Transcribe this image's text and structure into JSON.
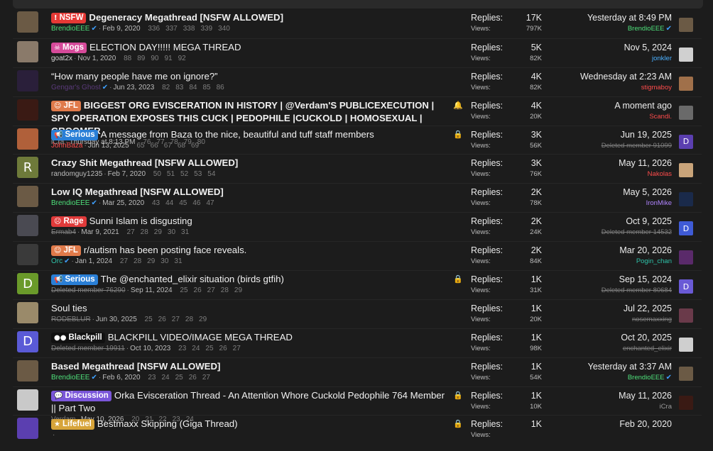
{
  "colors": {
    "nsfw": "#e53935",
    "mogs": "#d64a9a",
    "jfl": "#e07a4a",
    "serious": "#2a7fd6",
    "rage": "#e03a3a",
    "blackpill": "#111111",
    "discussion": "#7a56d9",
    "lifefuel": "#d7a43a",
    "user_red": "#ff4c4c",
    "user_orange": "#e07a3a",
    "user_blue": "#4ab0ff",
    "user_green": "#4ee07a",
    "user_purple": "#b084ff",
    "user_teal": "#2ec1a8",
    "verified": "#3ea0ff"
  },
  "threads": [
    {
      "prefix": {
        "label": "NSFW",
        "icon": "!",
        "color": "#e53935"
      },
      "title": "Degeneracy Megathread [NSFW ALLOWED]",
      "bold": true,
      "author": "BrendioEEE",
      "author_color": "#4ee07a",
      "verified": true,
      "date": "Feb 9, 2020",
      "pages": [
        "336",
        "337",
        "338",
        "339",
        "340"
      ],
      "replies_label": "Replies:",
      "replies": "17K",
      "views_label": "Views:",
      "views": "797K",
      "last_date": "Yesterday at 8:49 PM",
      "last_user": "BrendioEEE",
      "last_user_color": "#4ee07a",
      "last_verified": true,
      "avatar_glyph": "",
      "avatar_bg": "#6b5a45",
      "last_avatar_glyph": "",
      "last_avatar_bg": "#6b5a45",
      "status": ""
    },
    {
      "prefix": {
        "label": "Mogs",
        "icon": "☠",
        "color": "#d64a9a"
      },
      "title": "ELECTION DAY!!!!! MEGA THREAD",
      "bold": false,
      "author": "goat2x",
      "author_color": "#d9d9d9",
      "verified": false,
      "date": "Nov 1, 2020",
      "pages": [
        "88",
        "89",
        "90",
        "91",
        "92"
      ],
      "replies_label": "Replies:",
      "replies": "5K",
      "views_label": "Views:",
      "views": "82K",
      "last_date": "Nov 5, 2024",
      "last_user": "jonkler",
      "last_user_color": "#4ab0ff",
      "last_verified": false,
      "avatar_glyph": "",
      "avatar_bg": "#8a7a6a",
      "last_avatar_glyph": "",
      "last_avatar_bg": "#d0d0d0",
      "status": ""
    },
    {
      "prefix": null,
      "title": "“How many people have me on ignore?”",
      "bold": false,
      "author": "Gengar's Ghost",
      "author_color": "#5a3a7a",
      "verified": true,
      "date": "Jun 23, 2023",
      "pages": [
        "82",
        "83",
        "84",
        "85",
        "86"
      ],
      "replies_label": "Replies:",
      "replies": "4K",
      "views_label": "Views:",
      "views": "82K",
      "last_date": "Wednesday at 2:23 AM",
      "last_user": "stigmaboy",
      "last_user_color": "#ff4c4c",
      "last_verified": false,
      "avatar_glyph": "",
      "avatar_bg": "#2a1f3a",
      "last_avatar_glyph": "",
      "last_avatar_bg": "#a0704a",
      "status": ""
    },
    {
      "prefix": {
        "label": "JFL",
        "icon": "☺",
        "color": "#e07a4a"
      },
      "title": "BIGGEST ORG EVISCERATION IN HISTORY | @Verdam'S PUBLICEXECUTION | SPY OPERATION EXPOSES THIS CUCK | PEDOPHILE |CUCKOLD | HOMOSEXUAL | GROOMER",
      "bold": true,
      "author": "iCra",
      "author_color": "#9a9a9a",
      "verified": false,
      "date": "Thursday at 8:13 PM",
      "pages": [
        "76",
        "77",
        "78",
        "79",
        "80"
      ],
      "replies_label": "Replies:",
      "replies": "4K",
      "views_label": "Views:",
      "views": "20K",
      "last_date": "A moment ago",
      "last_user": "Scandi.",
      "last_user_color": "#ff4c4c",
      "last_verified": false,
      "avatar_glyph": "",
      "avatar_bg": "#3a1a14",
      "last_avatar_glyph": "",
      "last_avatar_bg": "#6a6a6a",
      "status": "🔔"
    },
    {
      "prefix": {
        "label": "Serious",
        "icon": "📢",
        "color": "#2a7fd6"
      },
      "title": "A message from Baza to the nice, beautiful and tuff staff members",
      "bold": false,
      "author": "JohnBaza",
      "author_color": "#ff4c4c",
      "verified": false,
      "date": "Jun 13, 2025",
      "pages": [
        "65",
        "66",
        "67",
        "68",
        "69"
      ],
      "replies_label": "Replies:",
      "replies": "3K",
      "views_label": "Views:",
      "views": "56K",
      "last_date": "Jun 19, 2025",
      "last_user": "Deleted member 91099",
      "last_user_color": "#7f7f7f",
      "last_verified": false,
      "last_strike": true,
      "avatar_glyph": "",
      "avatar_bg": "#b0603a",
      "last_avatar_glyph": "D",
      "last_avatar_bg": "#5b3fb0",
      "status": "🔒"
    },
    {
      "prefix": null,
      "title": "Crazy Shit Megathread [NSFW ALLOWED]",
      "bold": true,
      "author": "randomguy1235",
      "author_color": "#bdbdbd",
      "verified": false,
      "date": "Feb 7, 2020",
      "pages": [
        "50",
        "51",
        "52",
        "53",
        "54"
      ],
      "replies_label": "Replies:",
      "replies": "3K",
      "views_label": "Views:",
      "views": "76K",
      "last_date": "May 11, 2026",
      "last_user": "Nakolas",
      "last_user_color": "#ff4c4c",
      "last_verified": false,
      "avatar_glyph": "R",
      "avatar_bg": "#6e7a3a",
      "last_avatar_glyph": "",
      "last_avatar_bg": "#c9a47a",
      "status": ""
    },
    {
      "prefix": null,
      "title": "Low IQ Megathread [NSFW ALLOWED]",
      "bold": true,
      "author": "BrendioEEE",
      "author_color": "#4ee07a",
      "verified": true,
      "date": "Mar 25, 2020",
      "pages": [
        "43",
        "44",
        "45",
        "46",
        "47"
      ],
      "replies_label": "Replies:",
      "replies": "2K",
      "views_label": "Views:",
      "views": "78K",
      "last_date": "May 5, 2026",
      "last_user": "IronMike",
      "last_user_color": "#b084ff",
      "last_verified": false,
      "avatar_glyph": "",
      "avatar_bg": "#6b5a45",
      "last_avatar_glyph": "",
      "last_avatar_bg": "#1a2a4a",
      "status": ""
    },
    {
      "prefix": {
        "label": "Rage",
        "icon": "☹",
        "color": "#e03a3a"
      },
      "title": "Sunni Islam is disgusting",
      "bold": false,
      "author": "Ermab4",
      "author_color": "#7f7f7f",
      "verified": false,
      "date": "Mar 9, 2021",
      "author_strike": true,
      "pages": [
        "27",
        "28",
        "29",
        "30",
        "31"
      ],
      "replies_label": "Replies:",
      "replies": "2K",
      "views_label": "Views:",
      "views": "24K",
      "last_date": "Oct 9, 2025",
      "last_user": "Deleted member 14532",
      "last_user_color": "#7f7f7f",
      "last_verified": false,
      "last_strike": true,
      "avatar_glyph": "",
      "avatar_bg": "#4a4a52",
      "last_avatar_glyph": "D",
      "last_avatar_bg": "#3f5bd6",
      "status": ""
    },
    {
      "prefix": {
        "label": "JFL",
        "icon": "☺",
        "color": "#e07a4a"
      },
      "title": "r/autism has been posting face reveals.",
      "bold": false,
      "author": "Orc",
      "author_color": "#2ec1a8",
      "verified": true,
      "date": "Jan 1, 2024",
      "pages": [
        "27",
        "28",
        "29",
        "30",
        "31"
      ],
      "replies_label": "Replies:",
      "replies": "2K",
      "views_label": "Views:",
      "views": "84K",
      "last_date": "Mar 20, 2026",
      "last_user": "Pogin_chan",
      "last_user_color": "#2ec1a8",
      "last_verified": false,
      "avatar_glyph": "",
      "avatar_bg": "#3a3a3a",
      "last_avatar_glyph": "",
      "last_avatar_bg": "#5a2a6a",
      "status": ""
    },
    {
      "prefix": {
        "label": "Serious",
        "icon": "📢",
        "color": "#2a7fd6"
      },
      "title": "The @enchanted_elixir situation (birds gtfih)",
      "bold": false,
      "author": "Deleted member 76290",
      "author_color": "#7f7f7f",
      "verified": false,
      "date": "Sep 11, 2024",
      "author_strike": true,
      "pages": [
        "25",
        "26",
        "27",
        "28",
        "29"
      ],
      "replies_label": "Replies:",
      "replies": "1K",
      "views_label": "Views:",
      "views": "31K",
      "last_date": "Sep 15, 2024",
      "last_user": "Deleted member 80684",
      "last_user_color": "#7f7f7f",
      "last_verified": false,
      "last_strike": true,
      "avatar_glyph": "D",
      "avatar_bg": "#6a9a2a",
      "last_avatar_glyph": "D",
      "last_avatar_bg": "#6a5ad6",
      "status": "🔒"
    },
    {
      "prefix": null,
      "title": "Soul ties",
      "bold": false,
      "author": "RODEBLUR",
      "author_color": "#7f7f7f",
      "verified": false,
      "date": "Jun 30, 2025",
      "author_strike": true,
      "pages": [
        "25",
        "26",
        "27",
        "28",
        "29"
      ],
      "replies_label": "Replies:",
      "replies": "1K",
      "views_label": "Views:",
      "views": "20K",
      "last_date": "Jul 22, 2025",
      "last_user": "nosemaxxing",
      "last_user_color": "#7f7f7f",
      "last_verified": false,
      "last_strike": true,
      "avatar_glyph": "",
      "avatar_bg": "#9a8a6a",
      "last_avatar_glyph": "",
      "last_avatar_bg": "#6a3a4a",
      "status": ""
    },
    {
      "prefix": {
        "label": "Blackpill",
        "icon": "●●",
        "color": "#111111"
      },
      "title": "BLACKPILL VIDEO/IMAGE MEGA THREAD",
      "bold": false,
      "author": "Deleted member 19911",
      "author_color": "#7f7f7f",
      "verified": false,
      "date": "Oct 10, 2023",
      "author_strike": true,
      "pages": [
        "23",
        "24",
        "25",
        "26",
        "27"
      ],
      "replies_label": "Replies:",
      "replies": "1K",
      "views_label": "Views:",
      "views": "98K",
      "last_date": "Oct 20, 2025",
      "last_user": "enchanted_elixir",
      "last_user_color": "#7f7f7f",
      "last_verified": false,
      "last_strike": true,
      "avatar_glyph": "D",
      "avatar_bg": "#5a5ad6",
      "last_avatar_glyph": "",
      "last_avatar_bg": "#cfcfcf",
      "status": ""
    },
    {
      "prefix": null,
      "title": "Based Megathread [NSFW ALLOWED]",
      "bold": true,
      "author": "BrendioEEE",
      "author_color": "#4ee07a",
      "verified": true,
      "date": "Feb 6, 2020",
      "pages": [
        "23",
        "24",
        "25",
        "26",
        "27"
      ],
      "replies_label": "Replies:",
      "replies": "1K",
      "views_label": "Views:",
      "views": "54K",
      "last_date": "Yesterday at 3:37 AM",
      "last_user": "BrendioEEE",
      "last_user_color": "#4ee07a",
      "last_verified": true,
      "avatar_glyph": "",
      "avatar_bg": "#6b5a45",
      "last_avatar_glyph": "",
      "last_avatar_bg": "#6b5a45",
      "status": ""
    },
    {
      "prefix": {
        "label": "Discussion",
        "icon": "💬",
        "color": "#7a56d9"
      },
      "title": "Orka Evisceration Thread - An Attention Whore Cuckold Pedophile 764 Member || Part Two",
      "bold": false,
      "author": "Verdam",
      "author_color": "#7f7f7f",
      "verified": false,
      "date": "May 10, 2026",
      "author_strike": true,
      "pages": [
        "20",
        "21",
        "22",
        "23",
        "24"
      ],
      "replies_label": "Replies:",
      "replies": "1K",
      "views_label": "Views:",
      "views": "10K",
      "last_date": "May 11, 2026",
      "last_user": "iCra",
      "last_user_color": "#9a9a9a",
      "last_verified": false,
      "avatar_glyph": "",
      "avatar_bg": "#c9c9c9",
      "last_avatar_glyph": "",
      "last_avatar_bg": "#3a1a14",
      "status": "🔒"
    },
    {
      "prefix": {
        "label": "Lifefuel",
        "icon": "★",
        "color": "#d7a43a"
      },
      "title": "Bestmaxx Skipping (Giga Thread)",
      "bold": false,
      "author": "",
      "author_color": "#bdbdbd",
      "verified": false,
      "date": "",
      "pages": [],
      "replies_label": "Replies:",
      "replies": "1K",
      "views_label": "Views:",
      "views": "",
      "last_date": "Feb 20, 2020",
      "last_user": "",
      "last_user_color": "#bdbdbd",
      "last_verified": false,
      "avatar_glyph": "",
      "avatar_bg": "#5b3fb0",
      "last_avatar_glyph": "",
      "last_avatar_bg": "#1c1c1c",
      "status": "🔒"
    }
  ]
}
